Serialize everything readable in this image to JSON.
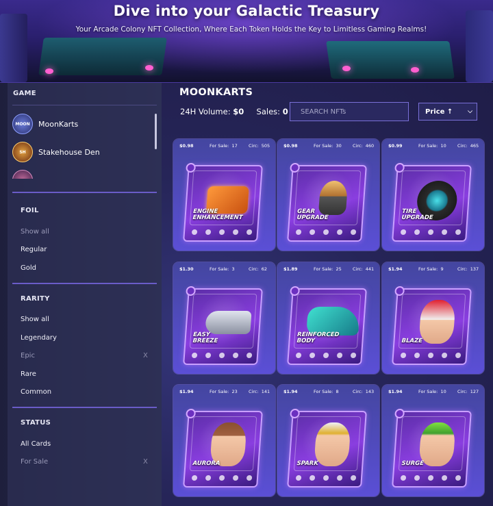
{
  "banner": {
    "title": "Dive into your Galactic Treasury",
    "subtitle": "Your Arcade Colony NFT Collection, Where Each Token Holds the Key to Limitless Gaming Realms!"
  },
  "sidebar": {
    "game_heading": "GAME",
    "games": [
      {
        "label": "MoonKarts",
        "logo": "moonkarts-logo"
      },
      {
        "label": "Stakehouse Den",
        "logo": "stakehouse-den-logo"
      },
      {
        "label": "",
        "logo": "game-logo"
      }
    ],
    "foil": {
      "heading": "FOIL",
      "options": [
        "Show all",
        "Regular",
        "Gold"
      ]
    },
    "rarity": {
      "heading": "RARITY",
      "options": [
        "Show all",
        "Legendary",
        "Epic",
        "Rare",
        "Common"
      ],
      "selected_clear": "X"
    },
    "status": {
      "heading": "STATUS",
      "options": [
        "All Cards",
        "For Sale"
      ],
      "selected_clear": "X"
    }
  },
  "main": {
    "title": "MOONKARTS",
    "volume_label": "24H Volume:",
    "volume_value": "$0",
    "sales_label": "Sales:",
    "sales_value": "0",
    "search_placeholder": "SEARCH NFTs",
    "sort_label": "Price ↑",
    "for_sale_label": "For Sale:",
    "circ_label": "Circ:"
  },
  "cards": [
    {
      "price": "$0.98",
      "for_sale": "17",
      "circ": "505",
      "name_line1": "ENGINE",
      "name_line2": "ENHANCEMENT",
      "icon": "engine-icon"
    },
    {
      "price": "$0.98",
      "for_sale": "30",
      "circ": "460",
      "name_line1": "GEAR",
      "name_line2": "UPGRADE",
      "icon": "gear-shift-icon"
    },
    {
      "price": "$0.99",
      "for_sale": "10",
      "circ": "465",
      "name_line1": "TIRE",
      "name_line2": "UPGRADE",
      "icon": "tire-icon"
    },
    {
      "price": "$1.30",
      "for_sale": "3",
      "circ": "62",
      "name_line1": "EASY",
      "name_line2": "BREEZE",
      "icon": "exhaust-icon"
    },
    {
      "price": "$1.89",
      "for_sale": "25",
      "circ": "441",
      "name_line1": "REINFORCED",
      "name_line2": "BODY",
      "icon": "kart-body-icon"
    },
    {
      "price": "$1.94",
      "for_sale": "9",
      "circ": "137",
      "name_line1": "",
      "name_line2": "BLAZE",
      "icon": "racer-helmet-icon"
    },
    {
      "price": "$1.94",
      "for_sale": "23",
      "circ": "141",
      "name_line1": "",
      "name_line2": "AURORA",
      "icon": "racer-girl-icon"
    },
    {
      "price": "$1.94",
      "for_sale": "8",
      "circ": "143",
      "name_line1": "",
      "name_line2": "SPARK",
      "icon": "racer-visor-icon"
    },
    {
      "price": "$1.94",
      "for_sale": "10",
      "circ": "127",
      "name_line1": "",
      "name_line2": "SURGE",
      "icon": "racer-cap-icon"
    }
  ],
  "colors": {
    "accent": "#7a70d8",
    "card_bg": "#5b4fd6",
    "sidebar_bg": "#2d2f55"
  }
}
